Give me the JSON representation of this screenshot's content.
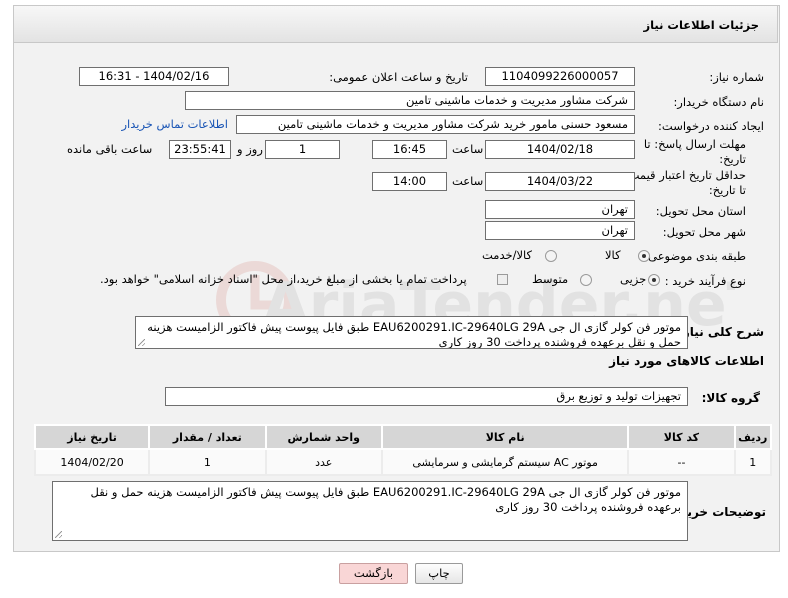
{
  "header": {
    "title": "جزئیات اطلاعات نیاز"
  },
  "form": {
    "need_number": {
      "label": "شماره نیاز:",
      "value": "1104099226000057"
    },
    "announce_datetime": {
      "label": "تاریخ و ساعت اعلان عمومی:",
      "value": "1404/02/16 - 16:31"
    },
    "buyer_org": {
      "label": "نام دستگاه خریدار:",
      "value": "شرکت مشاور مدیریت و خدمات ماشینی تامین"
    },
    "requester": {
      "label": "ایجاد کننده درخواست:",
      "value": "مسعود حسنی مامور خرید شرکت مشاور مدیریت و خدمات ماشینی تامین",
      "contact_link": "اطلاعات تماس خریدار"
    },
    "reply_deadline": {
      "label_line1": "مهلت ارسال پاسخ: تا",
      "label_line2": "تاریخ:",
      "date": "1404/02/18",
      "time_label": "ساعت",
      "time": "16:45",
      "days": "1",
      "days_label": "روز و",
      "remaining": "23:55:41",
      "remaining_label": "ساعت باقی مانده"
    },
    "price_validity": {
      "label_line1": "حداقل تاریخ اعتبار قیمت:",
      "label_line2": "تا تاریخ:",
      "date": "1404/03/22",
      "time_label": "ساعت",
      "time": "14:00"
    },
    "delivery_province": {
      "label": "استان محل تحویل:",
      "value": "تهران"
    },
    "delivery_city": {
      "label": "شهر محل تحویل:",
      "value": "تهران"
    },
    "category": {
      "label": "طبقه بندی موضوعی:",
      "options": [
        "کالا",
        "کالا/خدمت"
      ],
      "selected": "کالا"
    },
    "process_type": {
      "label": "نوع فرآیند خرید :",
      "options": [
        "جزیی",
        "متوسط"
      ],
      "selected": "جزیی",
      "payment_note": "پرداخت تمام یا بخشی از مبلغ خرید،از محل \"اسناد خزانه اسلامی\" خواهد بود."
    },
    "general_desc": {
      "label": "شرح کلی نیاز:",
      "value": "موتور فن  کولر گازی   ال جی  EAU6200291.IC-29640LG 29A  طبق فایل پیوست  پیش فاکتور الزامیست هزینه حمل و نقل برعهده فروشنده پرداخت 30 روز کاری"
    }
  },
  "goods_info": {
    "heading": "اطلاعات کالاهای مورد نیاز",
    "group_label": "گروه کالا:",
    "group_value": "تجهیزات تولید و توزیع برق",
    "columns": [
      "ردیف",
      "کد کالا",
      "نام کالا",
      "واحد شمارش",
      "تعداد / مقدار",
      "تاریخ نیاز"
    ],
    "rows": [
      {
        "row": "1",
        "code": "--",
        "name": "موتور AC سیستم گرمایشی و سرمایشی",
        "unit": "عدد",
        "qty": "1",
        "date": "1404/02/20"
      }
    ]
  },
  "buyer_notes": {
    "label": "توضیحات خریدار:",
    "value": "موتور فن  کولر گازی   ال جی  EAU6200291.IC-29640LG 29A  طبق فایل پیوست  پیش فاکتور الزامیست هزینه حمل و نقل برعهده فروشنده پرداخت 30 روز کاری"
  },
  "buttons": {
    "print": "چاپ",
    "back": "بازگشت"
  },
  "watermark": {
    "text": "AriaTender.neT"
  },
  "colors": {
    "link": "#1a55b5",
    "back_button": "#f9d6d6",
    "watermark": "#c0392b"
  }
}
